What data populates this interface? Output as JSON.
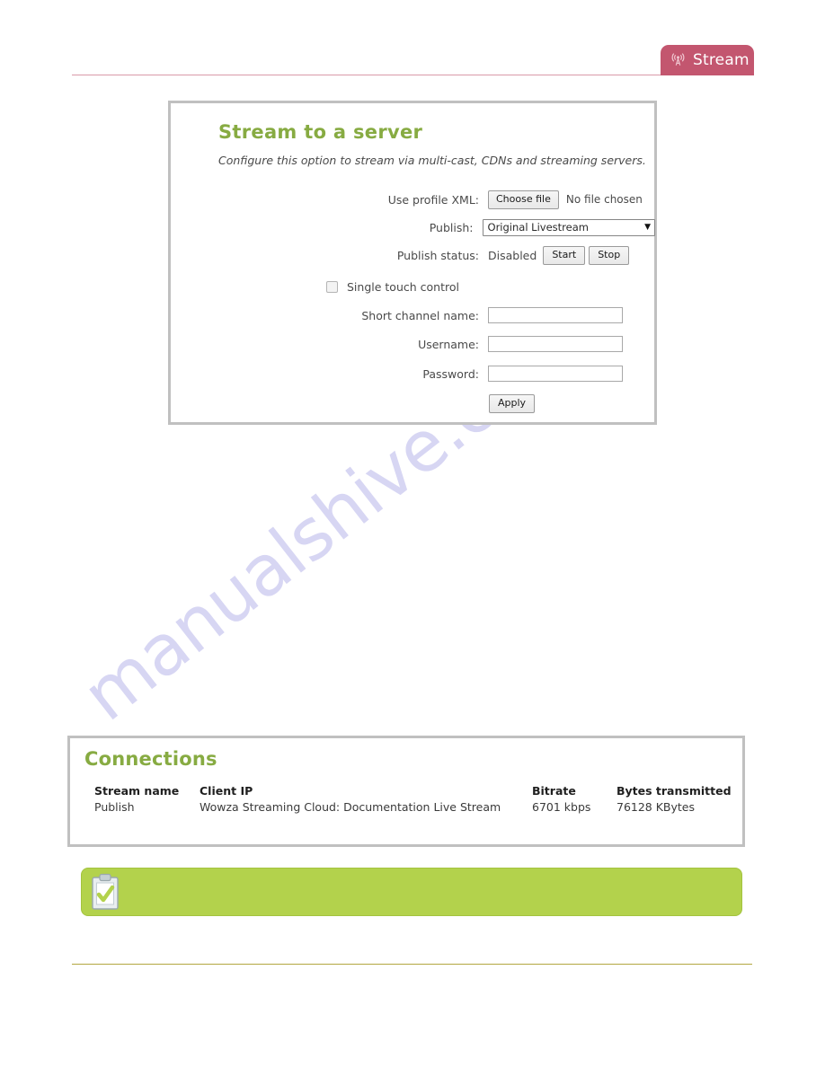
{
  "header": {
    "tab_label": "Stream",
    "tab_icon": "broadcast-antenna-icon",
    "tab_color": "#c3566f",
    "rule_color": "#d99aa9"
  },
  "watermark": {
    "text": "manualshive.com",
    "color": "#c9c7ef"
  },
  "stream_form": {
    "title": "Stream to a server",
    "title_color": "#87ab42",
    "subtitle": "Configure this option to stream via multi-cast, CDNs and streaming servers.",
    "profile_xml": {
      "label": "Use profile XML:",
      "button_label": "Choose file",
      "file_status": "No file chosen"
    },
    "publish": {
      "label": "Publish:",
      "selected": "Original Livestream",
      "options": [
        "Original Livestream"
      ],
      "caret_icon": "chevron-down-icon"
    },
    "publish_status": {
      "label": "Publish status:",
      "value": "Disabled",
      "start_label": "Start",
      "stop_label": "Stop"
    },
    "single_touch": {
      "label": "Single touch control",
      "checked": false
    },
    "short_channel_name": {
      "label": "Short channel name:",
      "value": ""
    },
    "username": {
      "label": "Username:",
      "value": ""
    },
    "password": {
      "label": "Password:",
      "value": ""
    },
    "apply_label": "Apply"
  },
  "connections": {
    "title": "Connections",
    "title_color": "#87ab42",
    "columns": [
      "Stream name",
      "Client IP",
      "Bitrate",
      "Bytes transmitted"
    ],
    "rows": [
      {
        "stream_name": "Publish",
        "client_ip": "Wowza Streaming Cloud: Documentation Live Stream",
        "bitrate": "6701 kbps",
        "bytes_transmitted": "76128 KBytes"
      }
    ]
  },
  "note_box": {
    "icon": "clipboard-check-icon",
    "text": "",
    "background_color": "#b3d24c"
  },
  "footer": {
    "rule_color": "#b3a740"
  }
}
